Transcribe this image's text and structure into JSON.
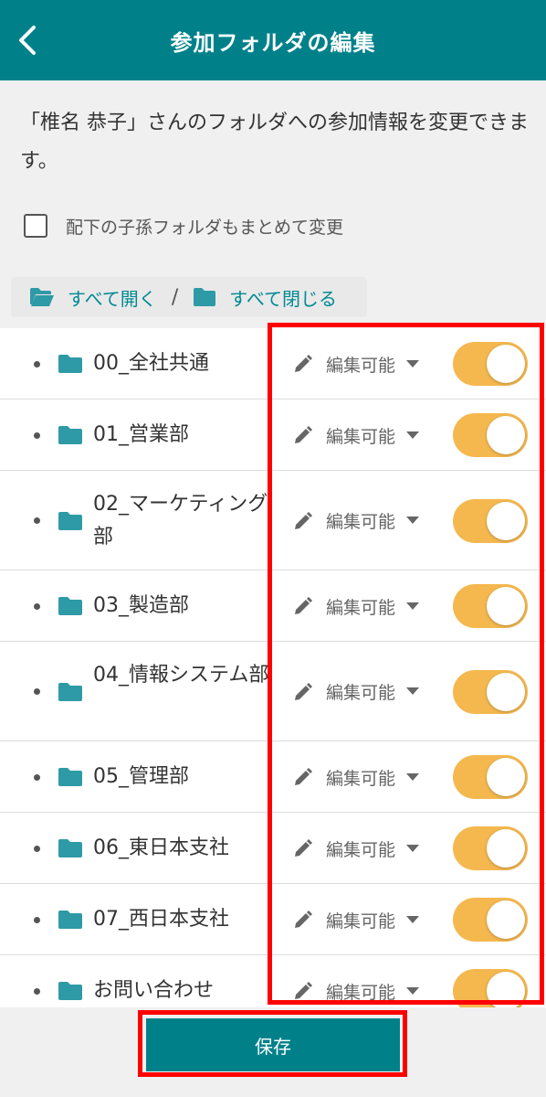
{
  "header": {
    "title": "参加フォルダの編集"
  },
  "description": "「椎名 恭子」さんのフォルダへの参加情報を変更できます。",
  "bulk_change": {
    "label": "配下の子孫フォルダもまとめて変更",
    "checked": false
  },
  "expand_controls": {
    "expand_all": "すべて開く",
    "separator": "/",
    "collapse_all": "すべて閉じる"
  },
  "folders": [
    {
      "name": "00_全社共通",
      "permission": "編集可能",
      "enabled": true
    },
    {
      "name": "01_営業部",
      "permission": "編集可能",
      "enabled": true
    },
    {
      "name": "02_マーケティング部",
      "permission": "編集可能",
      "enabled": true
    },
    {
      "name": "03_製造部",
      "permission": "編集可能",
      "enabled": true
    },
    {
      "name": "04_情報システム部",
      "permission": "編集可能",
      "enabled": true
    },
    {
      "name": "05_管理部",
      "permission": "編集可能",
      "enabled": true
    },
    {
      "name": "06_東日本支社",
      "permission": "編集可能",
      "enabled": true
    },
    {
      "name": "07_西日本支社",
      "permission": "編集可能",
      "enabled": true
    },
    {
      "name": "お問い合わせ",
      "permission": "編集可能",
      "enabled": true
    }
  ],
  "footer": {
    "save_label": "保存"
  },
  "colors": {
    "header": "#00818a",
    "toggle_on": "#f5b84f",
    "folder": "#2e9aa6",
    "highlight": "#ff0000"
  }
}
